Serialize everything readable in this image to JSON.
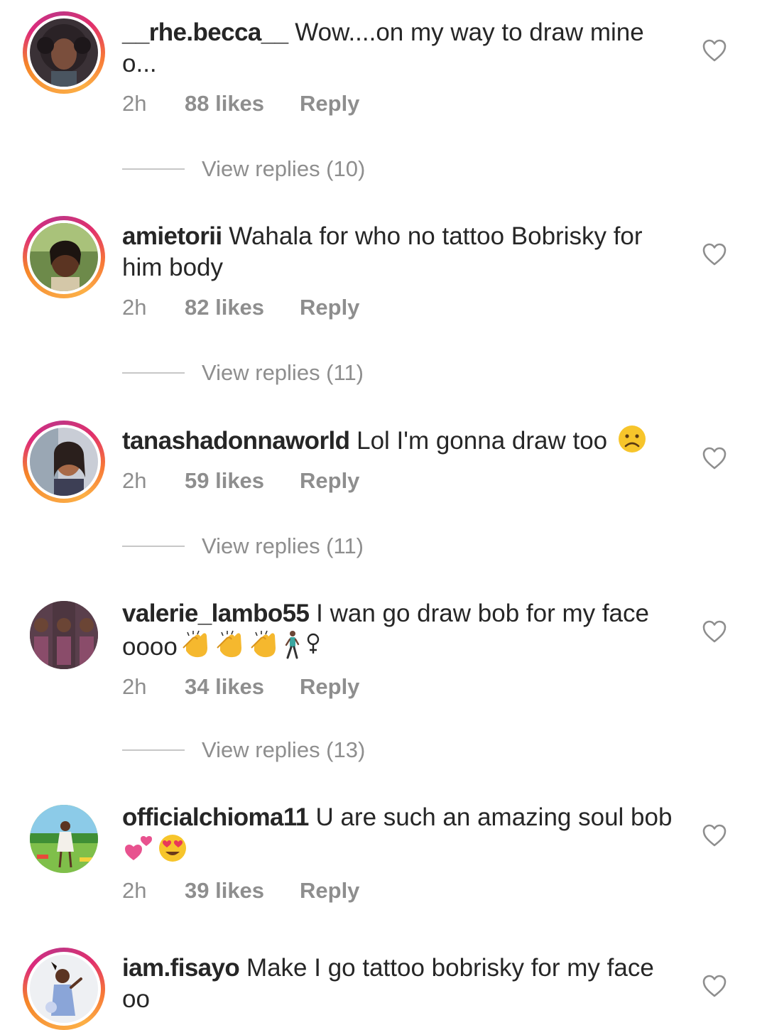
{
  "comments": [
    {
      "username": "__rhe.becca__",
      "text": "Wow....on my way to draw mine o...",
      "time": "2h",
      "likes": "88 likes",
      "reply": "Reply",
      "view_replies": "View replies (10)",
      "has_story_ring": true
    },
    {
      "username": "amietorii",
      "text": "Wahala for who no tattoo Bobrisky for him body",
      "time": "2h",
      "likes": "82 likes",
      "reply": "Reply",
      "view_replies": "View replies (11)",
      "has_story_ring": true
    },
    {
      "username": "tanashadonnaworld",
      "text": "Lol I'm gonna draw too",
      "emojis": [
        "frowning-face"
      ],
      "time": "2h",
      "likes": "59 likes",
      "reply": "Reply",
      "view_replies": "View replies (11)",
      "has_story_ring": true
    },
    {
      "username": "valerie_lambo55",
      "text": "I wan go draw bob for my face oooo",
      "emojis": [
        "clapping-hands",
        "clapping-hands",
        "clapping-hands",
        "person-walking",
        "female-sign"
      ],
      "time": "2h",
      "likes": "34 likes",
      "reply": "Reply",
      "view_replies": "View replies (13)",
      "has_story_ring": false
    },
    {
      "username": "officialchioma11",
      "text": "U are such an amazing soul bob",
      "emojis": [
        "two-hearts",
        "heart-eyes-face"
      ],
      "time": "2h",
      "likes": "39 likes",
      "reply": "Reply",
      "has_story_ring": false
    },
    {
      "username": "iam.fisayo",
      "text": "Make I go tattoo bobrisky for my face oo",
      "has_story_ring": true
    }
  ],
  "icons": {
    "like": "heart-outline-icon"
  },
  "colors": {
    "text": "#262626",
    "secondary": "#8e8e8e",
    "divider": "#c7c7c7",
    "story_ring_start": "#f58529",
    "story_ring_end": "#dd2a7b"
  }
}
